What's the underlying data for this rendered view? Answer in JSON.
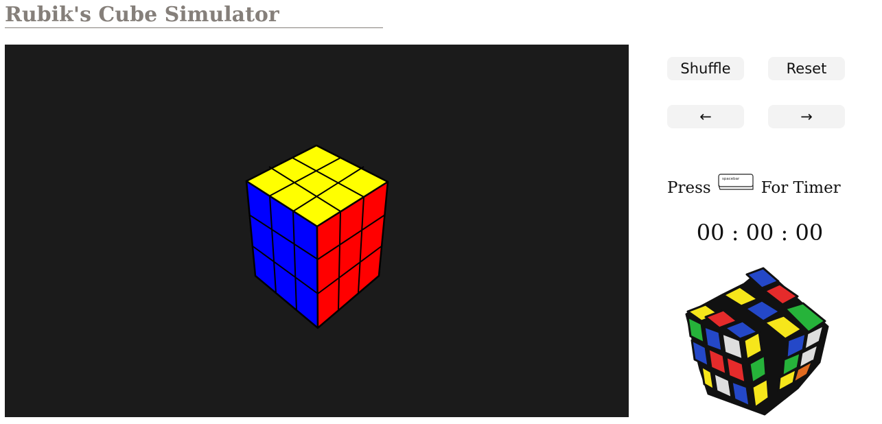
{
  "page": {
    "title": "Rubik's Cube Simulator"
  },
  "controls": {
    "shuffle_label": "Shuffle",
    "reset_label": "Reset",
    "undo_label": "←",
    "redo_label": "→"
  },
  "timer": {
    "press_label": "Press",
    "key_label": "spacebar",
    "suffix_label": "For Timer",
    "display": "00 : 00 : 00"
  },
  "icons": {
    "undo": "left-arrow-icon",
    "redo": "right-arrow-icon",
    "spacebar": "spacebar-key-icon",
    "cube_image": "rubiks-cube-illustration"
  },
  "colors": {
    "title": "#857f7a",
    "viewport_bg": "#1b1b1b",
    "button_bg": "#f3f3f3",
    "cube_top": "#ffff00",
    "cube_left": "#0000ff",
    "cube_right": "#ff0000"
  }
}
